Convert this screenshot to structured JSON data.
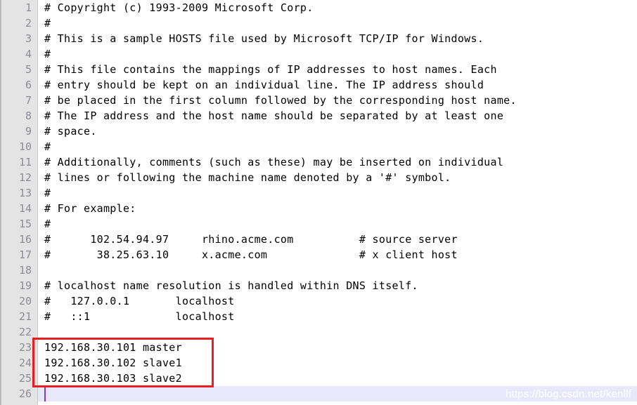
{
  "editor": {
    "title": "hosts",
    "total_lines": 26,
    "current_line": 26,
    "caret_column": 1,
    "colors": {
      "gutter_background": "#e4e4e4",
      "gutter_text": "#8c8c94",
      "code_background": "#ffffff",
      "code_text": "#000000",
      "current_line_highlight": "#e8e8fa",
      "caret": "#7b3fbf",
      "annotation_box": "#ec1c24",
      "watermark_text": "#ffffff"
    }
  },
  "line_numbers": [
    "1",
    "2",
    "3",
    "4",
    "5",
    "6",
    "7",
    "8",
    "9",
    "10",
    "11",
    "12",
    "13",
    "14",
    "15",
    "16",
    "17",
    "18",
    "19",
    "20",
    "21",
    "22",
    "23",
    "24",
    "25",
    "26"
  ],
  "lines": [
    {
      "n": 1,
      "text": "# Copyright (c) 1993-2009 Microsoft Corp.",
      "current": false
    },
    {
      "n": 2,
      "text": "#",
      "current": false
    },
    {
      "n": 3,
      "text": "# This is a sample HOSTS file used by Microsoft TCP/IP for Windows.",
      "current": false
    },
    {
      "n": 4,
      "text": "#",
      "current": false
    },
    {
      "n": 5,
      "text": "# This file contains the mappings of IP addresses to host names. Each",
      "current": false
    },
    {
      "n": 6,
      "text": "# entry should be kept on an individual line. The IP address should",
      "current": false
    },
    {
      "n": 7,
      "text": "# be placed in the first column followed by the corresponding host name.",
      "current": false
    },
    {
      "n": 8,
      "text": "# The IP address and the host name should be separated by at least one",
      "current": false
    },
    {
      "n": 9,
      "text": "# space.",
      "current": false
    },
    {
      "n": 10,
      "text": "#",
      "current": false
    },
    {
      "n": 11,
      "text": "# Additionally, comments (such as these) may be inserted on individual",
      "current": false
    },
    {
      "n": 12,
      "text": "# lines or following the machine name denoted by a '#' symbol.",
      "current": false
    },
    {
      "n": 13,
      "text": "#",
      "current": false
    },
    {
      "n": 14,
      "text": "# For example:",
      "current": false
    },
    {
      "n": 15,
      "text": "#",
      "current": false
    },
    {
      "n": 16,
      "text": "#      102.54.94.97     rhino.acme.com          # source server",
      "current": false
    },
    {
      "n": 17,
      "text": "#       38.25.63.10     x.acme.com              # x client host",
      "current": false
    },
    {
      "n": 18,
      "text": "",
      "current": false
    },
    {
      "n": 19,
      "text": "# localhost name resolution is handled within DNS itself.",
      "current": false
    },
    {
      "n": 20,
      "text": "#   127.0.0.1       localhost",
      "current": false
    },
    {
      "n": 21,
      "text": "#   ::1             localhost",
      "current": false
    },
    {
      "n": 22,
      "text": "",
      "current": false
    },
    {
      "n": 23,
      "text": "192.168.30.101 master",
      "current": false
    },
    {
      "n": 24,
      "text": "192.168.30.102 slave1",
      "current": false
    },
    {
      "n": 25,
      "text": "192.168.30.103 slave2",
      "current": false
    },
    {
      "n": 26,
      "text": "",
      "current": true
    }
  ],
  "annotation": {
    "type": "red-rectangle",
    "covers_lines": [
      23,
      24,
      25
    ],
    "label": "highlighted-host-entries"
  },
  "watermark": {
    "text": "https://blog.csdn.net/kenllf"
  }
}
